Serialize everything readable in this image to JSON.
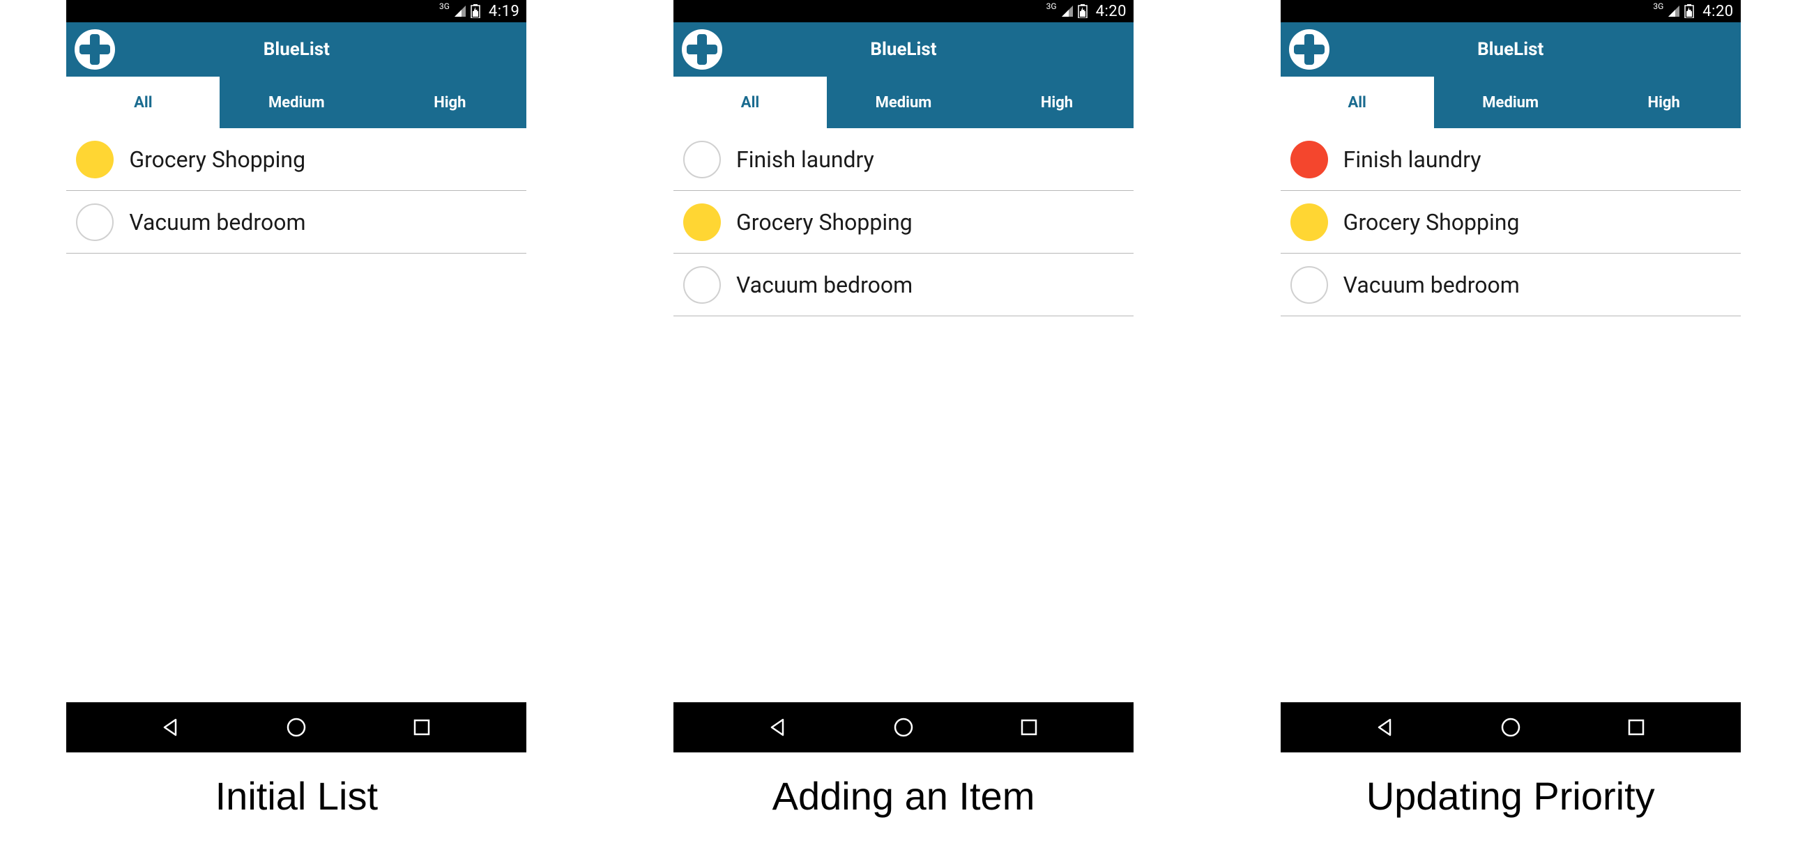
{
  "captions": {
    "screen1": "Initial List",
    "screen2": "Adding an Item",
    "screen3": "Updating Priority"
  },
  "app_title": "BlueList",
  "tabs": {
    "all": "All",
    "medium": "Medium",
    "high": "High"
  },
  "statusbar": {
    "network": "3G",
    "time1": "4:19",
    "time2": "4:20",
    "time3": "4:20"
  },
  "colors": {
    "appbar": "#1a6b8f",
    "priority_medium": "#ffd633",
    "priority_high": "#f4462d"
  },
  "screen1": {
    "items": [
      {
        "text": "Grocery Shopping",
        "priority": "medium"
      },
      {
        "text": "Vacuum bedroom",
        "priority": "none"
      }
    ]
  },
  "screen2": {
    "items": [
      {
        "text": "Finish laundry",
        "priority": "none"
      },
      {
        "text": "Grocery Shopping",
        "priority": "medium"
      },
      {
        "text": "Vacuum bedroom",
        "priority": "none"
      }
    ]
  },
  "screen3": {
    "items": [
      {
        "text": "Finish laundry",
        "priority": "high"
      },
      {
        "text": "Grocery Shopping",
        "priority": "medium"
      },
      {
        "text": "Vacuum bedroom",
        "priority": "none"
      }
    ]
  }
}
